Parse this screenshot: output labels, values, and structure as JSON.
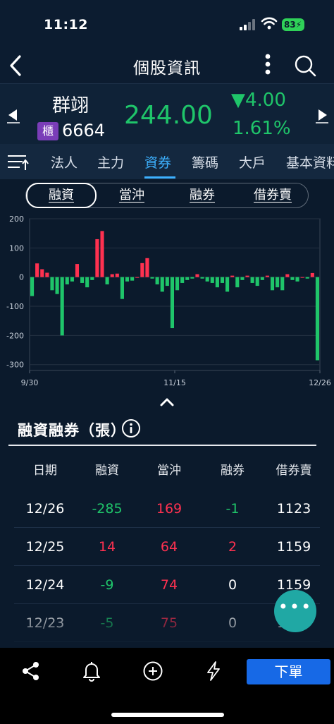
{
  "status": {
    "time": "11:12",
    "battery": "83"
  },
  "nav": {
    "title": "個股資訊"
  },
  "quote": {
    "name": "群翊",
    "market_badge": "櫃",
    "code": "6664",
    "price": "244.00",
    "change": "▼4.00",
    "change_pct": "1.61%",
    "color_down": "#1fc56a",
    "color_up": "#ff3150"
  },
  "tabs": [
    "法人",
    "主力",
    "資券",
    "籌碼",
    "大戶",
    "基本資料"
  ],
  "active_tab": "資券",
  "segments": [
    "融資",
    "當沖",
    "融券",
    "借券賣"
  ],
  "active_segment": "融資",
  "section_title": "融資融券（張）",
  "table": {
    "headers": [
      "日期",
      "融資",
      "當沖",
      "融券",
      "借券賣"
    ],
    "rows": [
      [
        "12/26",
        "-285",
        "169",
        "-1",
        "1123"
      ],
      [
        "12/25",
        "14",
        "64",
        "2",
        "1159"
      ],
      [
        "12/24",
        "-9",
        "74",
        "0",
        "1159"
      ],
      [
        "12/23",
        "-5",
        "75",
        "0",
        "1178"
      ]
    ]
  },
  "fab": {
    "label": "•••"
  },
  "bottom": {
    "order_label": "下單"
  },
  "chart_data": {
    "type": "bar",
    "y_ticks": [
      "200",
      "100",
      "0",
      "-100",
      "-200",
      "-300"
    ],
    "x_ticks": [
      "9/30",
      "11/15",
      "12/26"
    ],
    "ylim": [
      -320,
      200
    ],
    "colors": {
      "positive": "#ff3150",
      "negative": "#1fc56a"
    },
    "values": [
      -65,
      47,
      27,
      15,
      -45,
      -58,
      -200,
      -25,
      -15,
      45,
      -20,
      -35,
      -10,
      130,
      158,
      -25,
      10,
      12,
      -75,
      -15,
      -12,
      0,
      48,
      65,
      -5,
      -25,
      -50,
      -30,
      -175,
      -45,
      -20,
      -10,
      -5,
      10,
      -5,
      -15,
      -20,
      -35,
      -20,
      -50,
      5,
      -35,
      -10,
      5,
      -20,
      -30,
      -10,
      5,
      -45,
      -35,
      -45,
      10,
      -10,
      -15,
      0,
      -5,
      14,
      -285
    ]
  }
}
